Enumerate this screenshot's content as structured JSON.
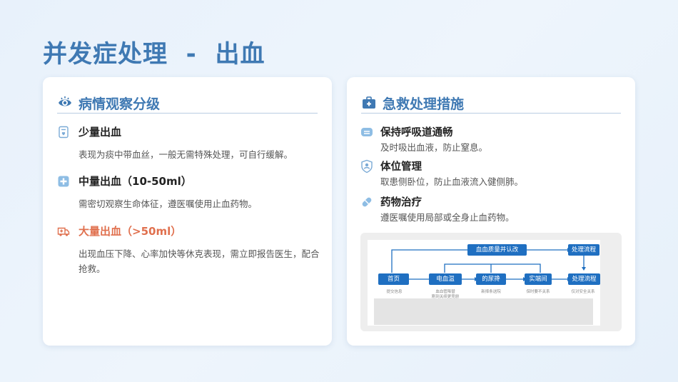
{
  "page": {
    "title": "并发症处理  -  出血"
  },
  "left_card": {
    "heading": "病情观察分级",
    "items": [
      {
        "title": "少量出血",
        "desc": "表现为痰中带血丝，一般无需特殊处理，可自行缓解。",
        "icon": "document-icon"
      },
      {
        "title": "中量出血（10-50ml）",
        "desc": "需密切观察生命体征，遵医嘱使用止血药物。",
        "icon": "medical-cross-icon"
      },
      {
        "title": "大量出血（>50ml）",
        "desc": "出现血压下降、心率加快等休克表现，需立即报告医生，配合抢救。",
        "icon": "ambulance-icon"
      }
    ],
    "accent_red": "#e0704e"
  },
  "right_card": {
    "heading": "急救处理措施",
    "items": [
      {
        "title": "保持呼吸道通畅",
        "desc": "及时吸出血液，防止窒息。",
        "icon": "mask-icon"
      },
      {
        "title": "体位管理",
        "desc": "取患侧卧位，防止血液流入健侧肺。",
        "icon": "shield-person-icon"
      },
      {
        "title": "药物治疗",
        "desc": "遵医嘱使用局部或全身止血药物。",
        "icon": "pill-icon"
      }
    ]
  },
  "flowchart": {
    "top_boxes": [
      "血血质量并认改",
      "处理流程"
    ],
    "main_boxes": [
      "首页",
      "电血温",
      "的尿搀",
      "实端间",
      "处理流程"
    ],
    "notes": [
      "提交信息",
      "血血管降替\n刚到关续更竞册",
      "新择条送院",
      "保时要不关系",
      "仅对安全关系"
    ]
  },
  "colors": {
    "brand": "#3f79b3",
    "flow_blue": "#1f6fc1"
  }
}
